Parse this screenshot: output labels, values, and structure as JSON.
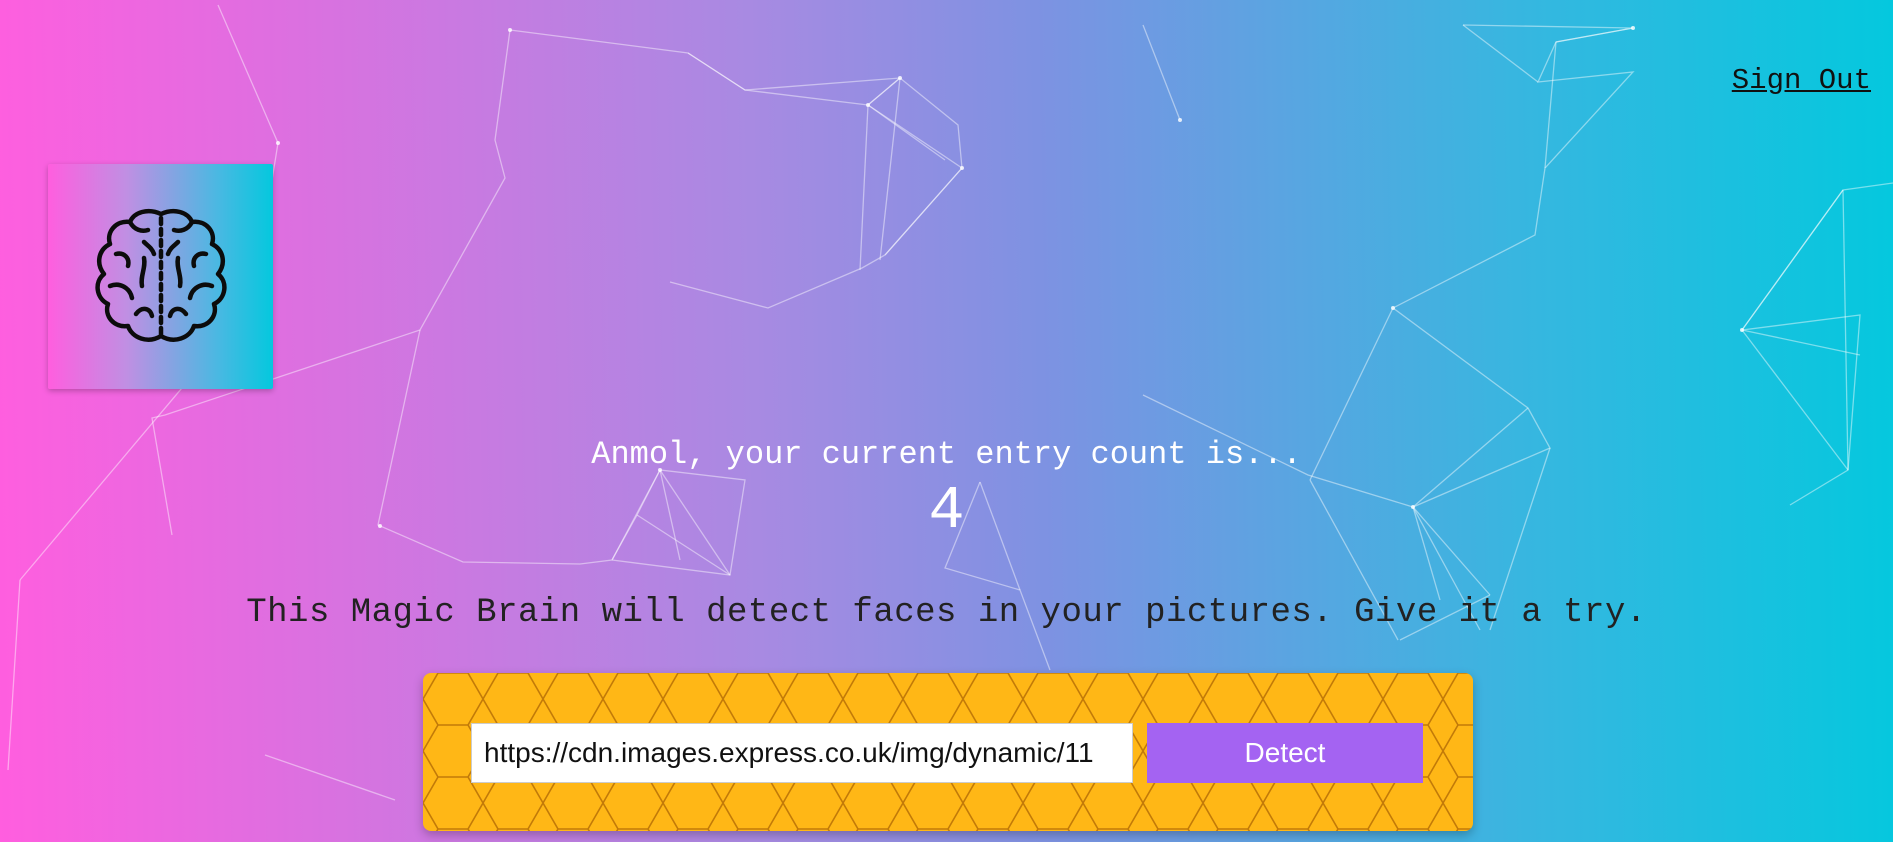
{
  "header": {
    "sign_out_label": "Sign Out"
  },
  "logo": {
    "icon": "brain-icon"
  },
  "rank": {
    "greeting": "Anmol, your current entry count is...",
    "count": "4"
  },
  "intro": {
    "tagline": "This Magic Brain will detect faces in your pictures. Give it a try."
  },
  "form": {
    "url_value": "https://cdn.images.express.co.uk/img/dynamic/11",
    "detect_label": "Detect"
  },
  "colors": {
    "gradient_start": "#ff5edf",
    "gradient_end": "#04c8de",
    "panel_yellow": "#ffb716",
    "button_purple": "#a463f2"
  }
}
